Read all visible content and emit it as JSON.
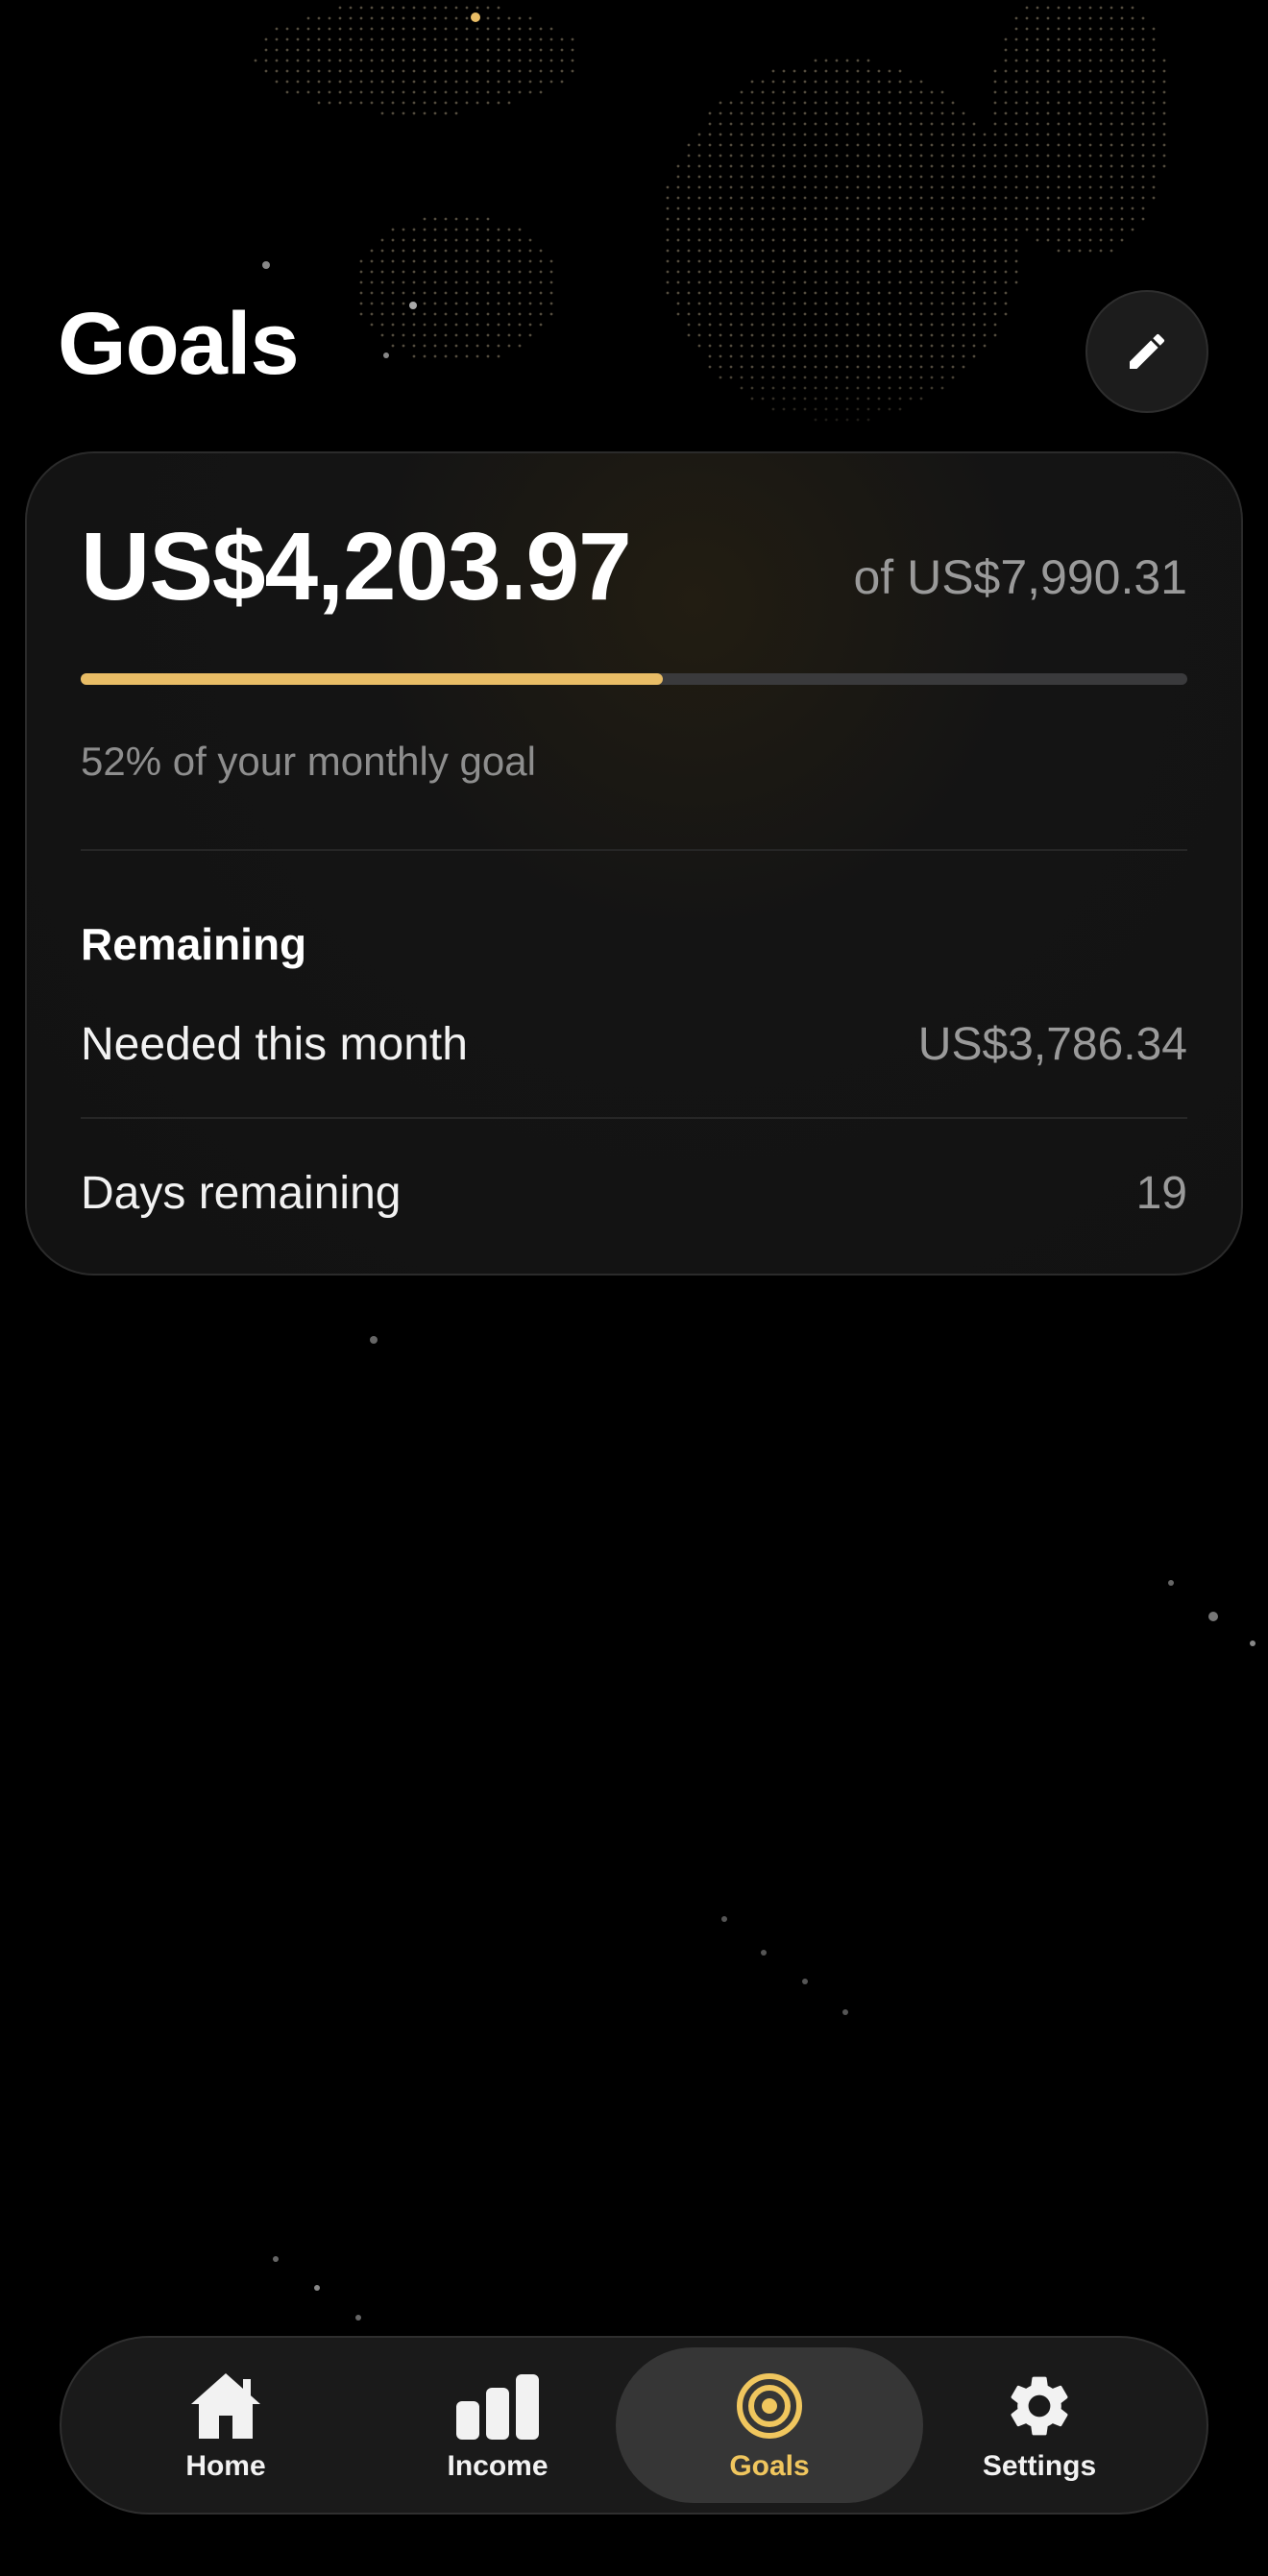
{
  "header": {
    "title": "Goals",
    "edit_icon": "pencil-icon"
  },
  "goal_card": {
    "current_amount": "US$4,203.97",
    "goal_text": "of US$7,990.31",
    "progress_fraction": 0.526,
    "progress_caption": "52% of your monthly goal",
    "remaining_heading": "Remaining",
    "rows": [
      {
        "label": "Needed this month",
        "value": "US$3,786.34"
      },
      {
        "label": "Days remaining",
        "value": "19"
      }
    ]
  },
  "tabbar": {
    "active": "Goals",
    "tabs": [
      {
        "label": "Home",
        "icon": "house-icon"
      },
      {
        "label": "Income",
        "icon": "bar-chart-icon"
      },
      {
        "label": "Goals",
        "icon": "target-icon"
      },
      {
        "label": "Settings",
        "icon": "gear-icon"
      }
    ]
  },
  "colors": {
    "background": "#000000",
    "accent": "#e9bd66",
    "card": "#141414",
    "muted_text": "#9a9a9a"
  }
}
